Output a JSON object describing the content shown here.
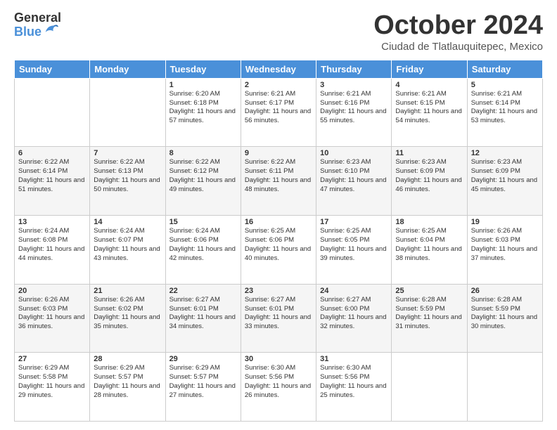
{
  "logo": {
    "general": "General",
    "blue": "Blue"
  },
  "title": "October 2024",
  "subtitle": "Ciudad de Tlatlauquitepec, Mexico",
  "headers": [
    "Sunday",
    "Monday",
    "Tuesday",
    "Wednesday",
    "Thursday",
    "Friday",
    "Saturday"
  ],
  "weeks": [
    [
      {
        "day": "",
        "info": ""
      },
      {
        "day": "",
        "info": ""
      },
      {
        "day": "1",
        "info": "Sunrise: 6:20 AM\nSunset: 6:18 PM\nDaylight: 11 hours and 57 minutes."
      },
      {
        "day": "2",
        "info": "Sunrise: 6:21 AM\nSunset: 6:17 PM\nDaylight: 11 hours and 56 minutes."
      },
      {
        "day": "3",
        "info": "Sunrise: 6:21 AM\nSunset: 6:16 PM\nDaylight: 11 hours and 55 minutes."
      },
      {
        "day": "4",
        "info": "Sunrise: 6:21 AM\nSunset: 6:15 PM\nDaylight: 11 hours and 54 minutes."
      },
      {
        "day": "5",
        "info": "Sunrise: 6:21 AM\nSunset: 6:14 PM\nDaylight: 11 hours and 53 minutes."
      }
    ],
    [
      {
        "day": "6",
        "info": "Sunrise: 6:22 AM\nSunset: 6:14 PM\nDaylight: 11 hours and 51 minutes."
      },
      {
        "day": "7",
        "info": "Sunrise: 6:22 AM\nSunset: 6:13 PM\nDaylight: 11 hours and 50 minutes."
      },
      {
        "day": "8",
        "info": "Sunrise: 6:22 AM\nSunset: 6:12 PM\nDaylight: 11 hours and 49 minutes."
      },
      {
        "day": "9",
        "info": "Sunrise: 6:22 AM\nSunset: 6:11 PM\nDaylight: 11 hours and 48 minutes."
      },
      {
        "day": "10",
        "info": "Sunrise: 6:23 AM\nSunset: 6:10 PM\nDaylight: 11 hours and 47 minutes."
      },
      {
        "day": "11",
        "info": "Sunrise: 6:23 AM\nSunset: 6:09 PM\nDaylight: 11 hours and 46 minutes."
      },
      {
        "day": "12",
        "info": "Sunrise: 6:23 AM\nSunset: 6:09 PM\nDaylight: 11 hours and 45 minutes."
      }
    ],
    [
      {
        "day": "13",
        "info": "Sunrise: 6:24 AM\nSunset: 6:08 PM\nDaylight: 11 hours and 44 minutes."
      },
      {
        "day": "14",
        "info": "Sunrise: 6:24 AM\nSunset: 6:07 PM\nDaylight: 11 hours and 43 minutes."
      },
      {
        "day": "15",
        "info": "Sunrise: 6:24 AM\nSunset: 6:06 PM\nDaylight: 11 hours and 42 minutes."
      },
      {
        "day": "16",
        "info": "Sunrise: 6:25 AM\nSunset: 6:06 PM\nDaylight: 11 hours and 40 minutes."
      },
      {
        "day": "17",
        "info": "Sunrise: 6:25 AM\nSunset: 6:05 PM\nDaylight: 11 hours and 39 minutes."
      },
      {
        "day": "18",
        "info": "Sunrise: 6:25 AM\nSunset: 6:04 PM\nDaylight: 11 hours and 38 minutes."
      },
      {
        "day": "19",
        "info": "Sunrise: 6:26 AM\nSunset: 6:03 PM\nDaylight: 11 hours and 37 minutes."
      }
    ],
    [
      {
        "day": "20",
        "info": "Sunrise: 6:26 AM\nSunset: 6:03 PM\nDaylight: 11 hours and 36 minutes."
      },
      {
        "day": "21",
        "info": "Sunrise: 6:26 AM\nSunset: 6:02 PM\nDaylight: 11 hours and 35 minutes."
      },
      {
        "day": "22",
        "info": "Sunrise: 6:27 AM\nSunset: 6:01 PM\nDaylight: 11 hours and 34 minutes."
      },
      {
        "day": "23",
        "info": "Sunrise: 6:27 AM\nSunset: 6:01 PM\nDaylight: 11 hours and 33 minutes."
      },
      {
        "day": "24",
        "info": "Sunrise: 6:27 AM\nSunset: 6:00 PM\nDaylight: 11 hours and 32 minutes."
      },
      {
        "day": "25",
        "info": "Sunrise: 6:28 AM\nSunset: 5:59 PM\nDaylight: 11 hours and 31 minutes."
      },
      {
        "day": "26",
        "info": "Sunrise: 6:28 AM\nSunset: 5:59 PM\nDaylight: 11 hours and 30 minutes."
      }
    ],
    [
      {
        "day": "27",
        "info": "Sunrise: 6:29 AM\nSunset: 5:58 PM\nDaylight: 11 hours and 29 minutes."
      },
      {
        "day": "28",
        "info": "Sunrise: 6:29 AM\nSunset: 5:57 PM\nDaylight: 11 hours and 28 minutes."
      },
      {
        "day": "29",
        "info": "Sunrise: 6:29 AM\nSunset: 5:57 PM\nDaylight: 11 hours and 27 minutes."
      },
      {
        "day": "30",
        "info": "Sunrise: 6:30 AM\nSunset: 5:56 PM\nDaylight: 11 hours and 26 minutes."
      },
      {
        "day": "31",
        "info": "Sunrise: 6:30 AM\nSunset: 5:56 PM\nDaylight: 11 hours and 25 minutes."
      },
      {
        "day": "",
        "info": ""
      },
      {
        "day": "",
        "info": ""
      }
    ]
  ]
}
